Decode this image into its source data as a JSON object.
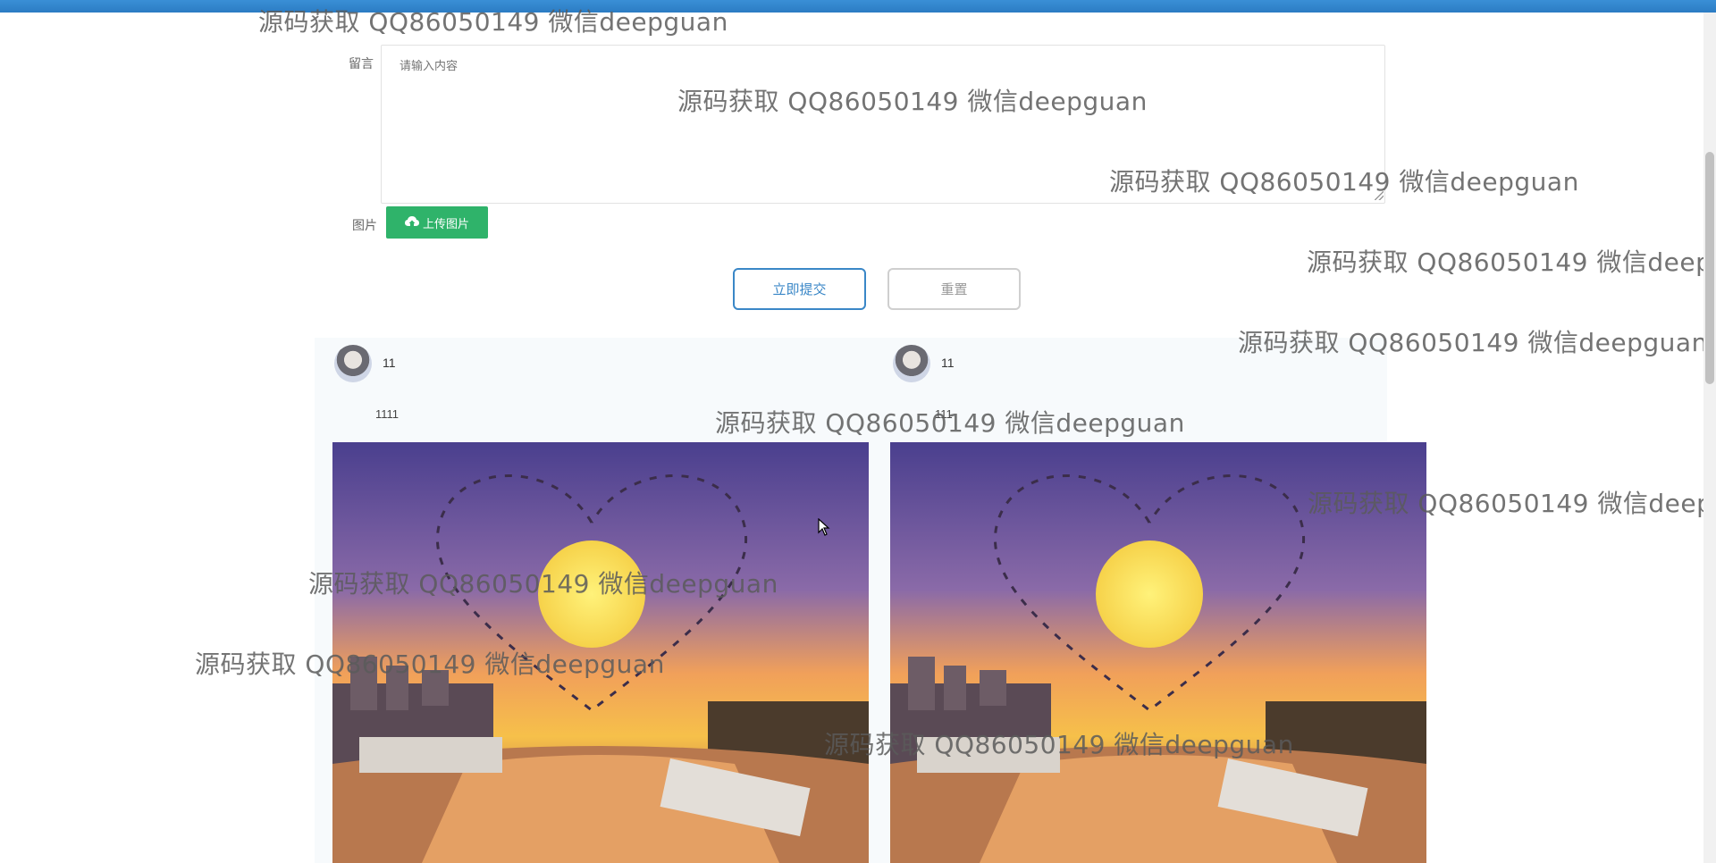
{
  "form": {
    "message_label": "留言",
    "message_placeholder": "请输入内容",
    "image_label": "图片",
    "upload_label": "上传图片",
    "submit_label": "立即提交",
    "reset_label": "重置"
  },
  "comments": [
    {
      "user": "11",
      "text": "1111"
    },
    {
      "user": "11",
      "text": "111"
    }
  ],
  "watermark": "源码获取 QQ86050149 微信deepguan",
  "colors": {
    "accent": "#2fb36a",
    "primary": "#3a87c7",
    "topbar": "#2b7cc3"
  }
}
